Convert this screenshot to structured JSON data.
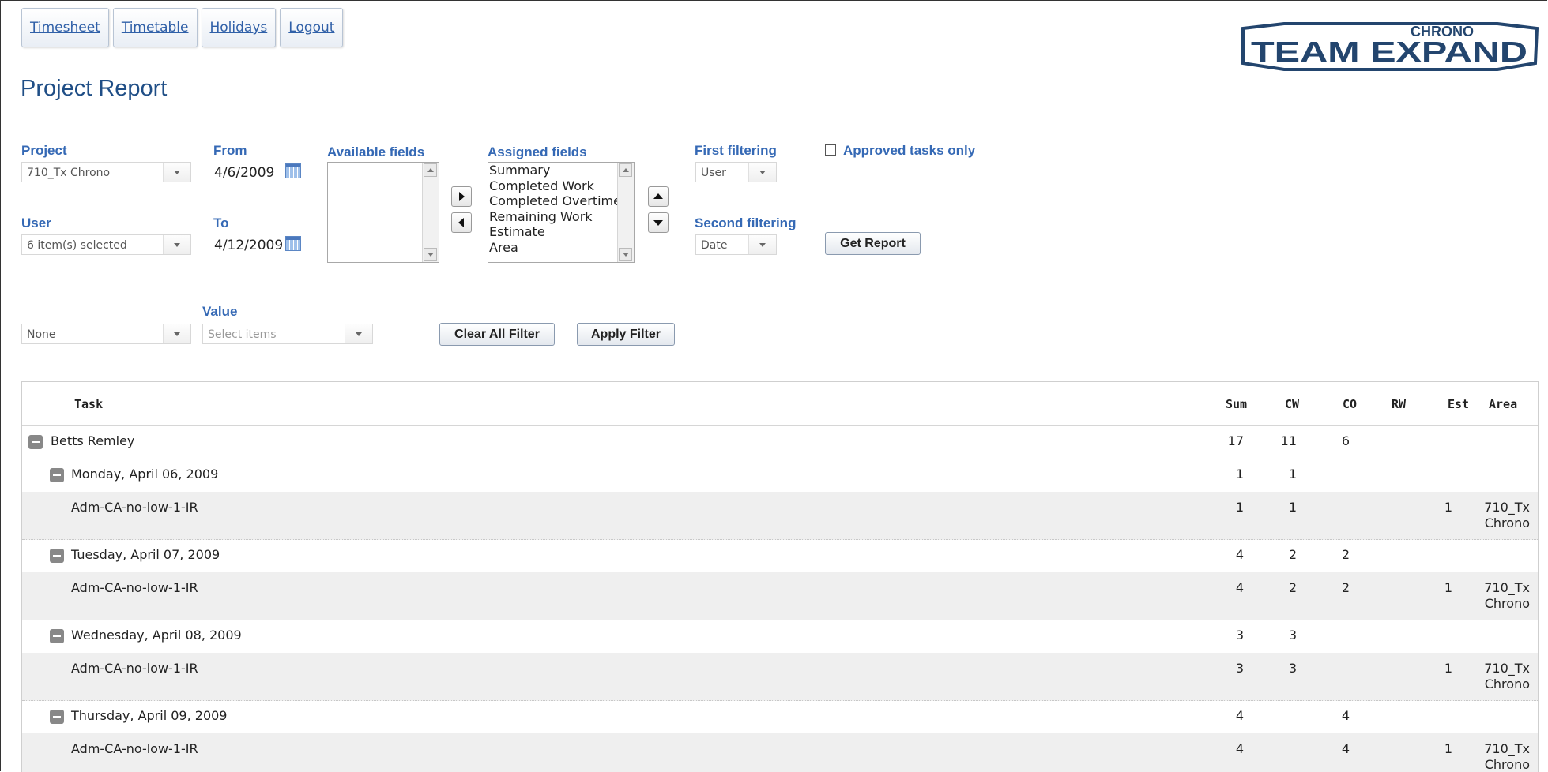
{
  "nav": [
    "Timesheet",
    "Timetable",
    "Holidays",
    "Logout"
  ],
  "logo": {
    "top": "CHRONO",
    "main": "TEAM EXPAND"
  },
  "page_title": "Project Report",
  "form": {
    "project_label": "Project",
    "project_value": "710_Tx Chrono",
    "user_label": "User",
    "user_value": "6 item(s) selected",
    "from_label": "From",
    "from_value": "4/6/2009",
    "to_label": "To",
    "to_value": "4/12/2009",
    "available_label": "Available fields",
    "assigned_label": "Assigned fields",
    "assigned_items": [
      "Summary",
      "Completed Work",
      "Completed Overtime",
      "Remaining Work",
      "Estimate",
      "Area"
    ],
    "first_filter_label": "First filtering",
    "first_filter_value": "User",
    "second_filter_label": "Second filtering",
    "second_filter_value": "Date",
    "approved_label": "Approved tasks only",
    "get_report": "Get Report",
    "filter_field_value": "None",
    "value_label": "Value",
    "value_placeholder": "Select items",
    "clear_filter": "Clear All Filter",
    "apply_filter": "Apply Filter"
  },
  "grid": {
    "headers": {
      "task": "Task",
      "sum": "Sum",
      "cw": "CW",
      "co": "CO",
      "rw": "RW",
      "est": "Est",
      "area": "Area"
    },
    "rows": [
      {
        "level": 0,
        "task": "Betts Remley",
        "sum": "17",
        "cw": "11",
        "co": "6",
        "rw": "",
        "est": "",
        "area": [
          "",
          ""
        ]
      },
      {
        "level": 1,
        "task": "Monday, April 06, 2009",
        "sum": "1",
        "cw": "1",
        "co": "",
        "rw": "",
        "est": "",
        "area": [
          "",
          ""
        ]
      },
      {
        "level": 2,
        "task": "Adm-CA-no-low-1-IR",
        "sum": "1",
        "cw": "1",
        "co": "",
        "rw": "",
        "est": "1",
        "area": [
          "710_Tx",
          "Chrono"
        ]
      },
      {
        "level": 1,
        "task": "Tuesday, April 07, 2009",
        "sum": "4",
        "cw": "2",
        "co": "2",
        "rw": "",
        "est": "",
        "area": [
          "",
          ""
        ]
      },
      {
        "level": 2,
        "task": "Adm-CA-no-low-1-IR",
        "sum": "4",
        "cw": "2",
        "co": "2",
        "rw": "",
        "est": "1",
        "area": [
          "710_Tx",
          "Chrono"
        ]
      },
      {
        "level": 1,
        "task": "Wednesday, April 08, 2009",
        "sum": "3",
        "cw": "3",
        "co": "",
        "rw": "",
        "est": "",
        "area": [
          "",
          ""
        ]
      },
      {
        "level": 2,
        "task": "Adm-CA-no-low-1-IR",
        "sum": "3",
        "cw": "3",
        "co": "",
        "rw": "",
        "est": "1",
        "area": [
          "710_Tx",
          "Chrono"
        ]
      },
      {
        "level": 1,
        "task": "Thursday, April 09, 2009",
        "sum": "4",
        "cw": "",
        "co": "4",
        "rw": "",
        "est": "",
        "area": [
          "",
          ""
        ]
      },
      {
        "level": 2,
        "task": "Adm-CA-no-low-1-IR",
        "sum": "4",
        "cw": "",
        "co": "4",
        "rw": "",
        "est": "1",
        "area": [
          "710_Tx",
          "Chrono"
        ]
      }
    ]
  }
}
